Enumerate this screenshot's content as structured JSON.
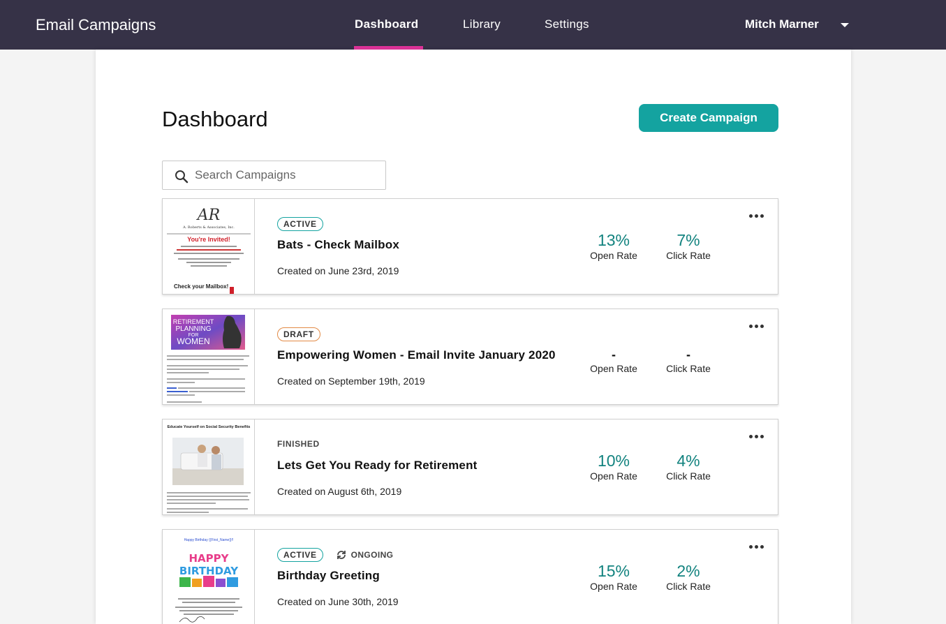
{
  "app": {
    "title": "Email Campaigns",
    "nav": [
      {
        "label": "Dashboard",
        "active": true
      },
      {
        "label": "Library",
        "active": false
      },
      {
        "label": "Settings",
        "active": false
      }
    ],
    "user_name": "Mitch Marner"
  },
  "page": {
    "title": "Dashboard",
    "create_button": "Create Campaign",
    "search_placeholder": "Search Campaigns"
  },
  "campaigns": [
    {
      "status": "ACTIVE",
      "status_type": "active",
      "extra_tag": "",
      "name": "Bats - Check Mailbox",
      "created": "Created on June 23rd, 2019",
      "open_rate": "13%",
      "click_rate": "7%",
      "open_label": "Open Rate",
      "click_label": "Click Rate",
      "thumb": {
        "logo": "AR",
        "company": "A. Roberts & Associates, Inc.",
        "headline": "You're Invited!",
        "footer": "Check your Mailbox!"
      }
    },
    {
      "status": "DRAFT",
      "status_type": "draft",
      "extra_tag": "",
      "name": "Empowering Women - Email Invite January 2020",
      "created": "Created on September 19th, 2019",
      "open_rate": "-",
      "click_rate": "-",
      "open_label": "Open Rate",
      "click_label": "Click Rate",
      "thumb": {
        "banner": [
          "RETIREMENT",
          "PLANNING",
          "FOR",
          "WOMEN"
        ]
      }
    },
    {
      "status": "FINISHED",
      "status_type": "finished",
      "extra_tag": "",
      "name": "Lets Get You Ready for Retirement",
      "created": "Created on August 6th, 2019",
      "open_rate": "10%",
      "click_rate": "4%",
      "open_label": "Open Rate",
      "click_label": "Click Rate",
      "thumb": {
        "headline": "Educate Yourself on Social Security Benefits"
      }
    },
    {
      "status": "ACTIVE",
      "status_type": "active",
      "extra_tag": "ONGOING",
      "name": "Birthday Greeting",
      "created": "Created on June 30th, 2019",
      "open_rate": "15%",
      "click_rate": "2%",
      "open_label": "Open Rate",
      "click_label": "Click Rate",
      "thumb": {
        "greeting": "Happy Birthday {{First_Name}}!!",
        "happy": "HAPPY",
        "birthday": "BIRTHDAY"
      }
    }
  ],
  "colors": {
    "topbar": "#363247",
    "accent_pink": "#e0339a",
    "teal": "#14a3a0",
    "teal_text": "#13837f",
    "draft_orange": "#e28a45"
  }
}
